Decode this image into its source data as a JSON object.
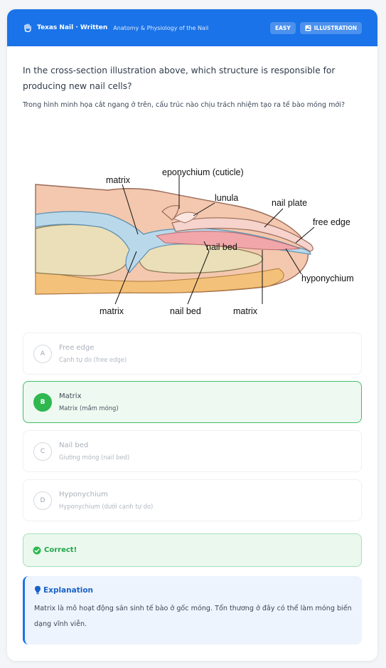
{
  "header": {
    "brand": "Texas Nail · Written",
    "topic": "Anatomy & Physiology of the Nail",
    "difficulty_badge": "EASY",
    "type_badge": "ILLUSTRATION",
    "color": "#1a73e8"
  },
  "question": {
    "text_en": "In the cross-section illustration above, which structure is responsible for producing new nail cells?",
    "text_vi": "Trong hình minh họa cắt ngang ở trên, cấu trúc nào chịu trách nhiệm tạo ra tế bào móng mới?"
  },
  "figure": {
    "labels": {
      "matrix_top": "matrix",
      "eponychium": "eponychium  (cuticle)",
      "lunula": "lunula",
      "nail_plate": "nail plate",
      "free_edge": "free edge",
      "nail_bed_inner": "nail bed",
      "hyponychium": "hyponychium",
      "matrix_bottom_left": "matrix",
      "nail_bed_bottom": "nail bed",
      "matrix_bottom_right": "matrix"
    }
  },
  "options": [
    {
      "letter": "A",
      "main": "Free edge",
      "sub": "Cạnh tự do (free edge)",
      "state": "neutral"
    },
    {
      "letter": "B",
      "main": "Matrix",
      "sub": "Matrix (mầm móng)",
      "state": "correct"
    },
    {
      "letter": "C",
      "main": "Nail bed",
      "sub": "Giường móng (nail bed)",
      "state": "neutral"
    },
    {
      "letter": "D",
      "main": "Hyponychium",
      "sub": "Hyponychium (dưới cạnh tự do)",
      "state": "neutral"
    }
  ],
  "result": {
    "text": "Correct!",
    "icon": "check-circle-icon",
    "color": "#21a447"
  },
  "explanation": {
    "title": "Explanation",
    "icon": "lightbulb-icon",
    "body": "Matrix là mô hoạt động sản sinh tế bào ở gốc móng. Tổn thương ở đây có thể làm móng biến dạng vĩnh viễn."
  }
}
